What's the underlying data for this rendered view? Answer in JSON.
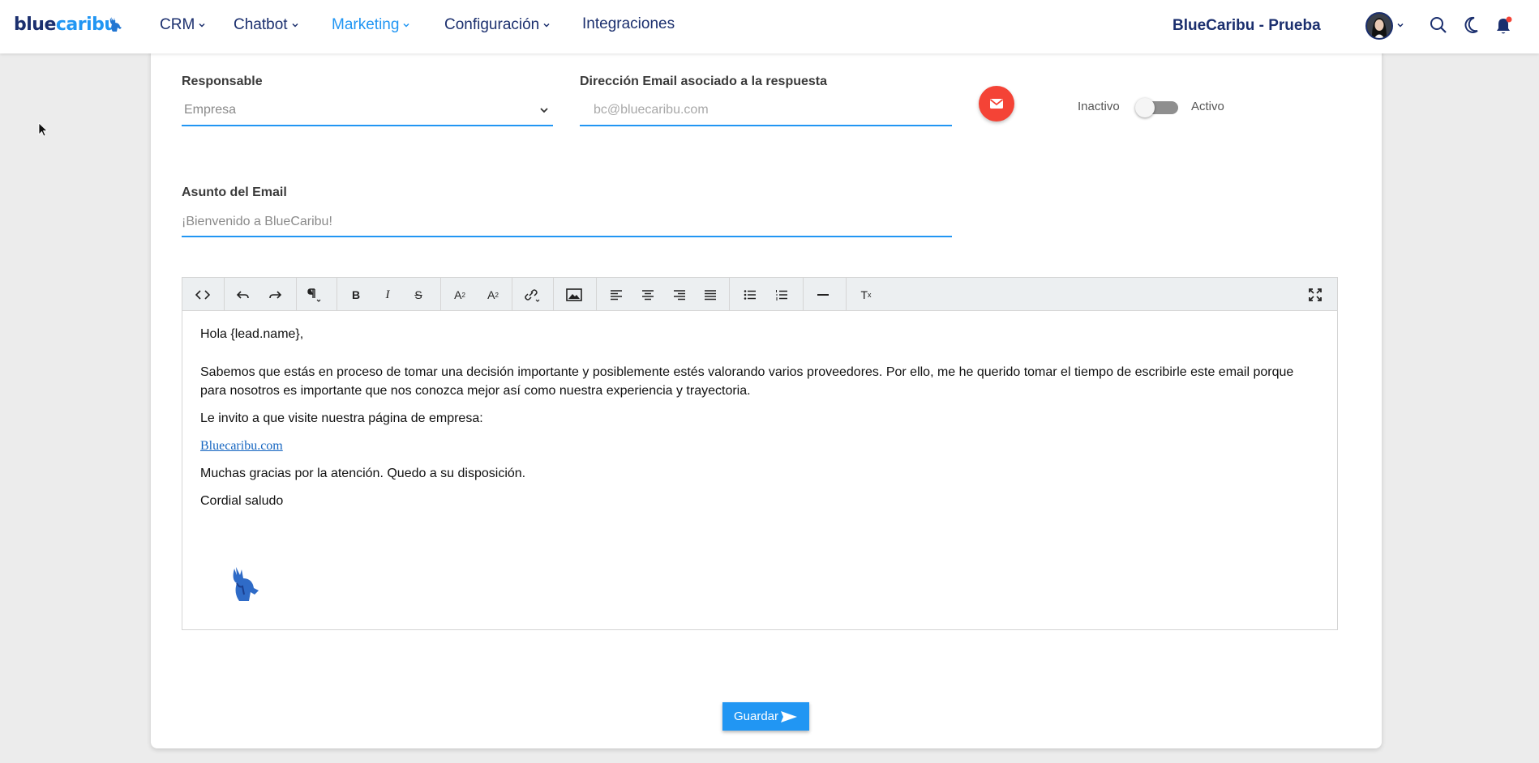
{
  "nav": {
    "logo_part1": "blue",
    "logo_part2": "caribu",
    "items": [
      {
        "label": "CRM"
      },
      {
        "label": "Chatbot"
      },
      {
        "label": "Marketing"
      },
      {
        "label": "Configuración"
      },
      {
        "label": "Integraciones"
      }
    ],
    "account_name": "BlueCaribu - Prueba",
    "icons": [
      "search-icon",
      "moon-icon",
      "bell-icon"
    ]
  },
  "form": {
    "responsable_label": "Responsable",
    "responsable_value": "Empresa",
    "email_label": "Dirección Email asociado a la respuesta",
    "email_placeholder": "bc@bluecaribu.com",
    "toggle_off_label": "Inactivo",
    "toggle_on_label": "Activo",
    "toggle_state": "off",
    "subject_label": "Asunto del Email",
    "subject_value": "¡Bienvenido a BlueCaribu!"
  },
  "editor": {
    "toolbar": [
      "code-view-icon",
      "undo-icon",
      "redo-icon",
      "paragraph-icon",
      "bold-icon",
      "italic-icon",
      "strikethrough-icon",
      "superscript-icon",
      "subscript-icon",
      "link-icon",
      "image-icon",
      "align-left-icon",
      "align-center-icon",
      "align-right-icon",
      "align-justify-icon",
      "bullet-list-icon",
      "numbered-list-icon",
      "horizontal-rule-icon",
      "clear-format-icon",
      "fullscreen-icon"
    ],
    "greeting": "Hola {lead.name},",
    "paragraph1_line1": "Sabemos que estás en proceso de tomar una decisión importante y posiblemente estés valorando varios proveedores. Por ello, me he querido tomar el tiempo de escribirle este email porque",
    "paragraph1_line2": "para nosotros es importante que nos conozca mejor así como nuestra experiencia y trayectoria.",
    "invite": "Le invito a que visite nuestra página de empresa:",
    "link": "Bluecaribu.com",
    "thanks": "Muchas gracias por la atención. Quedo a su disposición.",
    "closing": "Cordial saludo"
  },
  "save_label": "Guardar",
  "colors": {
    "primary": "#2196f3",
    "navy": "#1b2f6e",
    "danger": "#f44336"
  }
}
